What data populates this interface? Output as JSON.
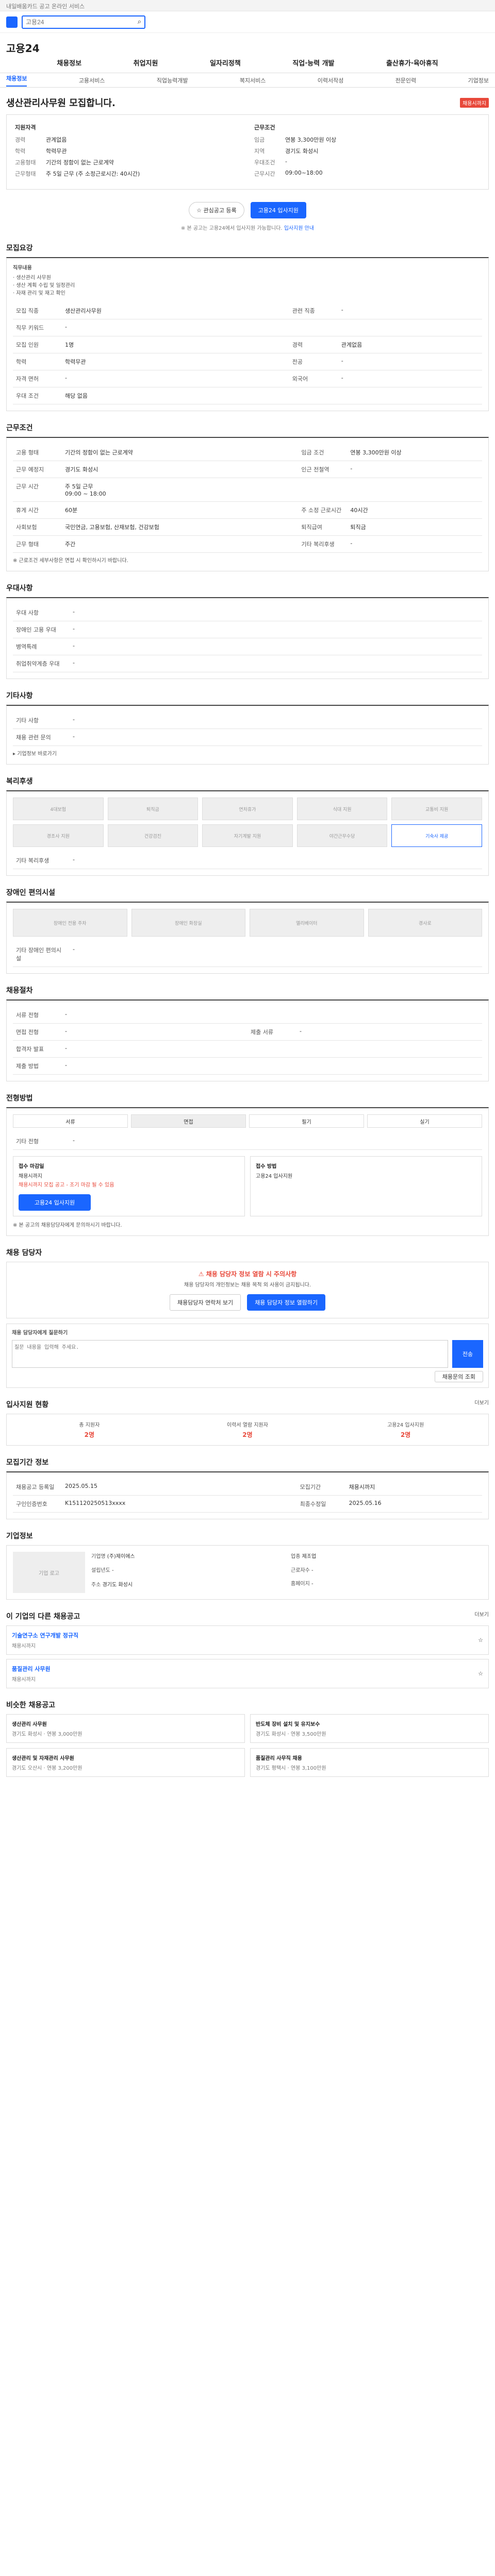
{
  "top": {
    "url_text": "내일배움카드 공고 온라인 서비스"
  },
  "search": {
    "placeholder": "고용24"
  },
  "brand": {
    "name": "고용24"
  },
  "gnb": [
    "채용정보",
    "취업지원",
    "일자리정책",
    "직업·능력 개발",
    "출산휴가·육아휴직"
  ],
  "subnav": {
    "active": "채용정보",
    "items": [
      "채용정보",
      "고용서비스",
      "직업능력개발",
      "복지서비스",
      "이력서작성",
      "전문인력",
      "기업정보"
    ]
  },
  "job": {
    "title": "생산관리사무원 모집합니다.",
    "status": "채용시까지",
    "summary_left_title": "지원자격",
    "summary_right_title": "근무조건",
    "left": [
      {
        "k": "경력",
        "v": "관계없음"
      },
      {
        "k": "학력",
        "v": "학력무관"
      },
      {
        "k": "고용형태",
        "v": "기간의 정함이 없는 근로계약"
      },
      {
        "k": "근무형태",
        "v": "주 5일 근무 (주 소정근로시간: 40시간)"
      }
    ],
    "right": [
      {
        "k": "임금",
        "v": "연봉 3,300만원 이상"
      },
      {
        "k": "지역",
        "v": "경기도 화성시"
      },
      {
        "k": "우대조건",
        "v": "-"
      },
      {
        "k": "근무시간",
        "v": "09:00~18:00"
      }
    ],
    "btn_interest": "관심공고 등록",
    "btn_apply": "고용24 입사지원",
    "note_prefix": "※ 본 공고는 고용24에서 입사지원 가능합니다.",
    "note_link": "입사지원 안내"
  },
  "sec_recruit": {
    "title": "모집요강",
    "duty_label": "직무내용",
    "duty_text": "· 생산관리 사무원\n· 생산 계획 수립 및 일정관리\n· 자재 관리 및 재고 확인",
    "rows": [
      {
        "k": "모집 직종",
        "v": "생산관리사무원",
        "k2": "관련 직종",
        "v2": "-"
      },
      {
        "k": "직무 키워드",
        "v": "-",
        "k2": "",
        "v2": ""
      },
      {
        "k": "모집 인원",
        "v": "1명",
        "k2": "경력",
        "v2": "관계없음"
      },
      {
        "k": "학력",
        "v": "학력무관",
        "k2": "전공",
        "v2": "-"
      },
      {
        "k": "자격 면허",
        "v": "-",
        "k2": "외국어",
        "v2": "-"
      },
      {
        "k": "우대 조건",
        "v": "해당 없음",
        "k2": "",
        "v2": ""
      }
    ]
  },
  "sec_cond": {
    "title": "근무조건",
    "rows": [
      {
        "k": "고용 형태",
        "v": "기간의 정함이 없는 근로계약",
        "k2": "임금 조건",
        "v2": "연봉 3,300만원 이상"
      },
      {
        "k": "근무 예정지",
        "v": "경기도 화성시",
        "k2": "인근 전철역",
        "v2": "-"
      },
      {
        "k": "근무 시간",
        "v": "주 5일 근무\n09:00 ~ 18:00",
        "k2": "",
        "v2": ""
      },
      {
        "k": "휴게 시간",
        "v": "60분",
        "k2": "주 소정 근로시간",
        "v2": "40시간"
      },
      {
        "k": "사회보험",
        "v": "국민연금, 고용보험, 산재보험, 건강보험",
        "k2": "퇴직급여",
        "v2": "퇴직금"
      },
      {
        "k": "근무 형태",
        "v": "주간",
        "k2": "기타 복리후생",
        "v2": "-"
      }
    ],
    "footnote": "※ 근로조건 세부사항은 면접 시 확인하시기 바랍니다."
  },
  "sec_welfare_text": {
    "title": "우대사항",
    "rows": [
      {
        "k": "우대 사항",
        "v": "-"
      },
      {
        "k": "장애인 고용 우대",
        "v": "-"
      },
      {
        "k": "병역특례",
        "v": "-"
      },
      {
        "k": "취업취약계층 우대",
        "v": "-"
      }
    ]
  },
  "sec_extra": {
    "title": "기타사항",
    "rows": [
      {
        "k": "기타 사항",
        "v": "-"
      },
      {
        "k": "채용 관련 문의",
        "v": "-"
      }
    ],
    "link": "기업정보 바로가기"
  },
  "sec_benefits": {
    "title": "복리후생",
    "tiles": [
      "4대보험",
      "퇴직금",
      "연차휴가",
      "식대 지원",
      "교통비 지원",
      "경조사 지원",
      "건강검진",
      "자기계발 지원",
      "야간근무수당",
      "기숙사 제공"
    ],
    "on_index": 9,
    "label": "기타 복리후생",
    "value": "-"
  },
  "sec_disability": {
    "title": "장애인 편의시설",
    "tiles": [
      "장애인 전용 주차",
      "장애인 화장실",
      "엘리베이터",
      "경사로"
    ],
    "label": "기타 장애인 편의시설",
    "value": "-"
  },
  "sec_process": {
    "title": "채용절차",
    "rows": [
      {
        "k": "서류 전형",
        "v": "-",
        "k2": "",
        "v2": ""
      },
      {
        "k": "면접 전형",
        "v": "-",
        "k2": "제출 서류",
        "v2": "-"
      },
      {
        "k": "합격자 발표",
        "v": "-",
        "k2": "",
        "v2": ""
      },
      {
        "k": "제출 방법",
        "v": "-",
        "k2": "",
        "v2": ""
      }
    ]
  },
  "sec_apply": {
    "title": "전형방법",
    "methods": [
      "서류",
      "면접",
      "필기",
      "실기"
    ],
    "selected": 1,
    "note_title": "기타 전형",
    "note": "-",
    "col1_h": "접수 마감일",
    "col1_v": "채용시까지",
    "col1_warn": "채용시까지 모집 공고 - 조기 마감 될 수 있음",
    "col2_h": "접수 방법",
    "col2_v": "고용24 입사지원",
    "apply_btn": "고용24 입사지원",
    "footnote": "※ 본 공고의 채용담당자에게 문의하시기 바랍니다."
  },
  "sec_contact": {
    "title": "채용 담당자",
    "warn_title": "채용 담당자 정보 열람 시 주의사항",
    "warn_text": "채용 담당자의 개인정보는 채용 목적 외 사용이 금지됩니다.",
    "btn1": "채용담당자 연락처 보기",
    "btn2": "채용 담당자 정보 열람하기",
    "inquiry_title": "채용 담당자에게 질문하기",
    "inquiry_placeholder": "질문 내용을 입력해 주세요.",
    "send": "전송",
    "inquiry_btn": "채용문의 조회"
  },
  "sec_stats": {
    "title": "입사지원 현황",
    "more": "더보기",
    "items": [
      {
        "label": "총 지원자",
        "value": "2명"
      },
      {
        "label": "이력서 열람 지원자",
        "value": "2명"
      },
      {
        "label": "고용24 입사지원",
        "value": "2명"
      }
    ]
  },
  "sec_info": {
    "title": "모집기간 정보",
    "rows": [
      {
        "k": "채용공고 등록일",
        "v": "2025.05.15",
        "k2": "모집기간",
        "v2": "채용시까지"
      },
      {
        "k": "구인인증번호",
        "v": "K151120250513xxxx",
        "k2": "최종수정일",
        "v2": "2025.05.16"
      }
    ]
  },
  "sec_company": {
    "title": "기업정보",
    "img": "기업 로고",
    "info": [
      {
        "k": "기업명",
        "v": "(주)제이에스"
      },
      {
        "k": "업종",
        "v": "제조업"
      },
      {
        "k": "설립년도",
        "v": "-"
      },
      {
        "k": "근로자수",
        "v": "-"
      },
      {
        "k": "주소",
        "v": "경기도 화성시"
      },
      {
        "k": "홈페이지",
        "v": "-"
      }
    ]
  },
  "sec_jobs": {
    "title": "이 기업의 다른 채용공고",
    "more": "더보기",
    "items": [
      {
        "title": "기술연구소 연구개발 정규직",
        "dead": "채용시까지"
      },
      {
        "title": "품질관리 사무원",
        "dead": "채용시까지"
      }
    ]
  },
  "sec_recommend": {
    "title": "비슷한 채용공고",
    "items": [
      {
        "t": "생산관리 사무원",
        "m": "경기도 화성시 · 연봉 3,000만원"
      },
      {
        "t": "반도체 장비 설치 및 유지보수",
        "m": "경기도 화성시 · 연봉 3,500만원"
      },
      {
        "t": "생산관리 및 자재관리 사무원",
        "m": "경기도 오산시 · 연봉 3,200만원"
      },
      {
        "t": "품질관리 사무직 채용",
        "m": "경기도 평택시 · 연봉 3,100만원"
      }
    ]
  }
}
